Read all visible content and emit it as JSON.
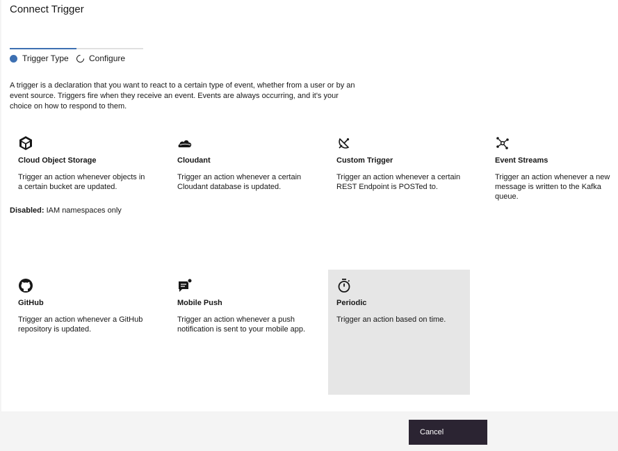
{
  "header": {
    "title": "Connect Trigger"
  },
  "steps": [
    {
      "label": "Trigger Type",
      "state": "active"
    },
    {
      "label": "Configure",
      "state": "inactive"
    }
  ],
  "intro": "A trigger is a declaration that you want to react to a certain type of event, whether from a user or by an event source. Triggers fire when they receive an event. Events are always occurring, and it's your choice on how to respond to them.",
  "cards": [
    {
      "name": "Cloud Object Storage",
      "icon": "cube-icon",
      "description": "Trigger an action whenever objects in a certain bucket are updated."
    },
    {
      "name": "Cloudant",
      "icon": "cloud-icon",
      "description": "Trigger an action whenever a certain Cloudant database is updated."
    },
    {
      "name": "Custom Trigger",
      "icon": "satellite-dish-icon",
      "description": "Trigger an action whenever a certain REST Endpoint is POSTed to."
    },
    {
      "name": "Event Streams",
      "icon": "event-streams-icon",
      "description": "Trigger an action whenever a new message is written to the Kafka queue."
    },
    {
      "name": "GitHub",
      "icon": "github-icon",
      "description": "Trigger an action whenever a GitHub repository is updated."
    },
    {
      "name": "Mobile Push",
      "icon": "chat-notification-icon",
      "description": "Trigger an action whenever a push notification is sent to your mobile app."
    },
    {
      "name": "Periodic",
      "icon": "stopwatch-icon",
      "description": "Trigger an action based on time.",
      "selected": true
    }
  ],
  "disabled_note": {
    "label": "Disabled:",
    "text": "IAM namespaces only"
  },
  "footer": {
    "cancel_label": "Cancel"
  },
  "colors": {
    "accent": "#3d70b2",
    "button_bg": "#2b2432",
    "selected_card_bg": "#e6e6e6",
    "footer_bg": "#f4f4f4"
  }
}
